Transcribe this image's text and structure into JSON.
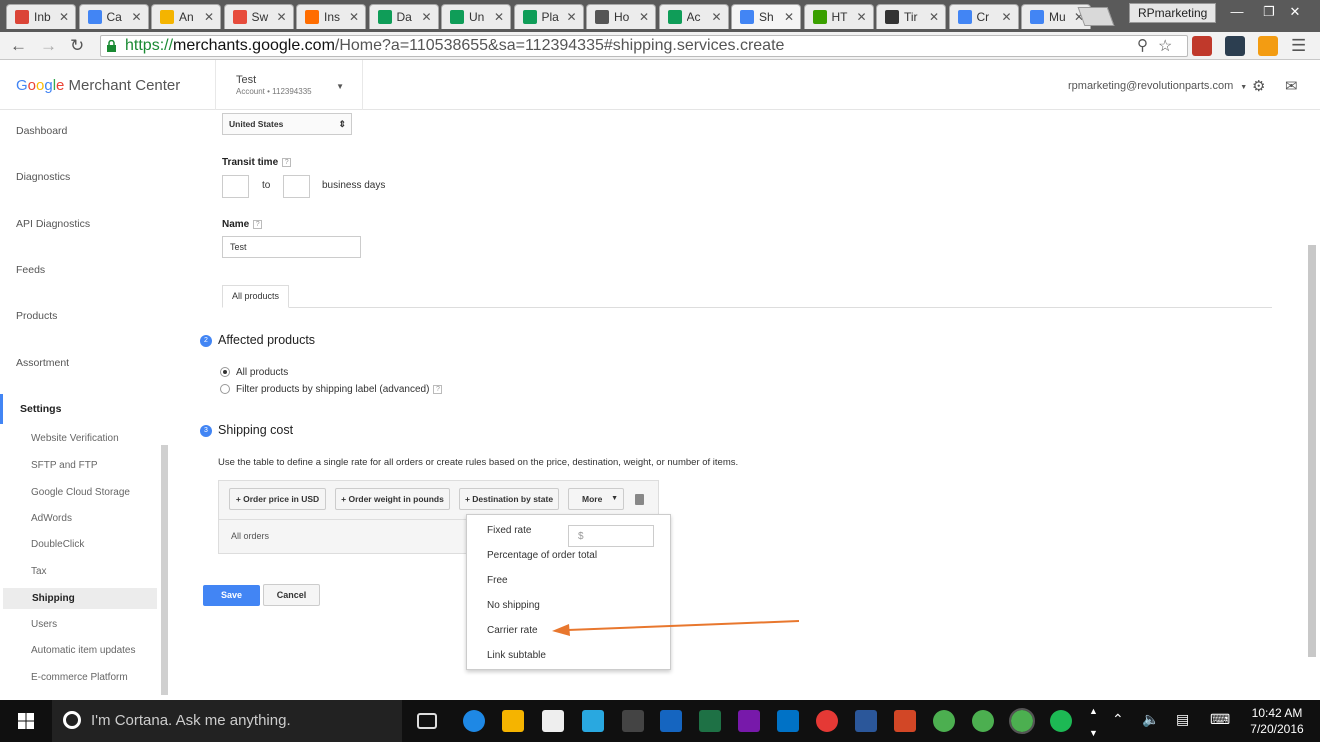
{
  "browser": {
    "tabs": [
      {
        "label": "Inb",
        "color": "#db4437"
      },
      {
        "label": "Ca",
        "color": "#4285f4"
      },
      {
        "label": "An",
        "color": "#f4b400"
      },
      {
        "label": "Sw",
        "color": "#e74c3c"
      },
      {
        "label": "Ins",
        "color": "#ff6d00"
      },
      {
        "label": "Da",
        "color": "#0f9d58"
      },
      {
        "label": "Un",
        "color": "#0f9d58"
      },
      {
        "label": "Pla",
        "color": "#0f9d58"
      },
      {
        "label": "Ho",
        "color": "#555555"
      },
      {
        "label": "Ac",
        "color": "#0f9d58"
      },
      {
        "label": "Sh",
        "color": "#4285f4"
      },
      {
        "label": "HT",
        "color": "#3aa000"
      },
      {
        "label": "Tir",
        "color": "#333333"
      },
      {
        "label": "Cr",
        "color": "#4285f4"
      },
      {
        "label": "Mu",
        "color": "#4285f4"
      }
    ],
    "profile": "RPmarketing",
    "url_scheme": "https://",
    "url_host": "merchants.google.com",
    "url_path": "/Home?a=110538655&sa=112394335#shipping.services.create"
  },
  "header": {
    "logo_google": [
      "G",
      "o",
      "o",
      "g",
      "l",
      "e"
    ],
    "logo_suffix": " Merchant Center",
    "account_name": "Test",
    "account_sub": "Account  •  112394335",
    "user_email": "rpmarketing@revolutionparts.com"
  },
  "sidebar": {
    "items": [
      "Dashboard",
      "Diagnostics",
      "API Diagnostics",
      "Feeds",
      "Products",
      "Assortment",
      "Settings"
    ],
    "subitems": [
      "Website Verification",
      "SFTP and FTP",
      "Google Cloud Storage",
      "AdWords",
      "DoubleClick",
      "Tax",
      "Shipping",
      "Users",
      "Automatic item updates",
      "E-commerce Platform"
    ]
  },
  "form": {
    "country": "United States",
    "transit_label": "Transit time",
    "transit_to": "to",
    "transit_unit": "business days",
    "name_label": "Name",
    "name_value": "Test",
    "tab_all_products": "All products",
    "step2_num": "2",
    "step2_title": "Affected products",
    "radio_all": "All products",
    "radio_filter": "Filter products by shipping label (advanced)",
    "step3_num": "3",
    "step3_title": "Shipping cost",
    "cost_desc": "Use the table to define a single rate for all orders or create rules based on the price, destination, weight, or number of items.",
    "btn_order_price": "+ Order price in USD",
    "btn_order_weight": "+ Order weight in pounds",
    "btn_destination": "+ Destination by state",
    "btn_more": "More",
    "row_all_orders": "All orders",
    "price_placeholder": "$",
    "menu_items": [
      "Fixed rate",
      "Percentage of order total",
      "Free",
      "No shipping",
      "Carrier rate",
      "Link subtable"
    ],
    "save": "Save",
    "cancel": "Cancel"
  },
  "annotation": {
    "arrow_color": "#e8772e"
  },
  "taskbar": {
    "cortana": "I'm Cortana. Ask me anything.",
    "time": "10:42 AM",
    "date": "7/20/2016"
  }
}
